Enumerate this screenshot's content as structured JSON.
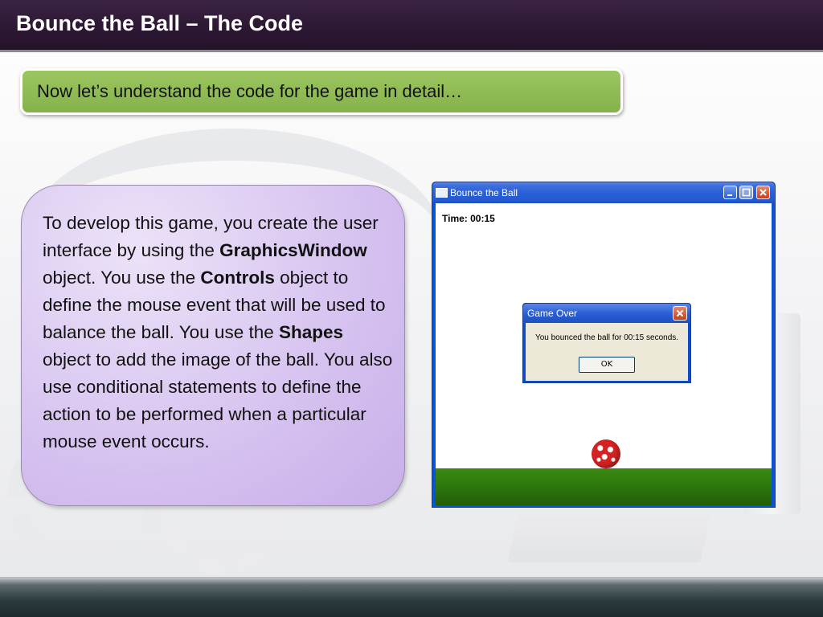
{
  "slide": {
    "title": "Bounce the Ball – The Code",
    "banner_text": "Now let’s understand the code for the game in detail…",
    "body": {
      "t1": "To develop this game, you create the user interface by using the ",
      "b1": "GraphicsWindow",
      "t2": " object. You use the ",
      "b2": "Controls",
      "t3": " object to define the mouse event that will  be used to balance the ball. You use the ",
      "b3": "Shapes",
      "t4": " object to add the image of the ball. You also use conditional statements to define the action to be performed when a particular mouse event occurs."
    }
  },
  "screenshot": {
    "window_title": "Bounce the Ball",
    "time_label": "Time: 00:15",
    "dialog": {
      "title": "Game Over",
      "message": "You bounced the ball for 00:15 seconds.",
      "ok_label": "OK"
    },
    "icons": {
      "minimize": "minimize-icon",
      "maximize": "maximize-icon",
      "close": "close-icon",
      "ball": "ball-icon"
    }
  },
  "colors": {
    "header_bg": "#2d1834",
    "banner_green": "#8fbc55",
    "panel_purple": "#d7c4f0",
    "ball_red": "#d42222",
    "ground_green": "#2f7a0d"
  }
}
